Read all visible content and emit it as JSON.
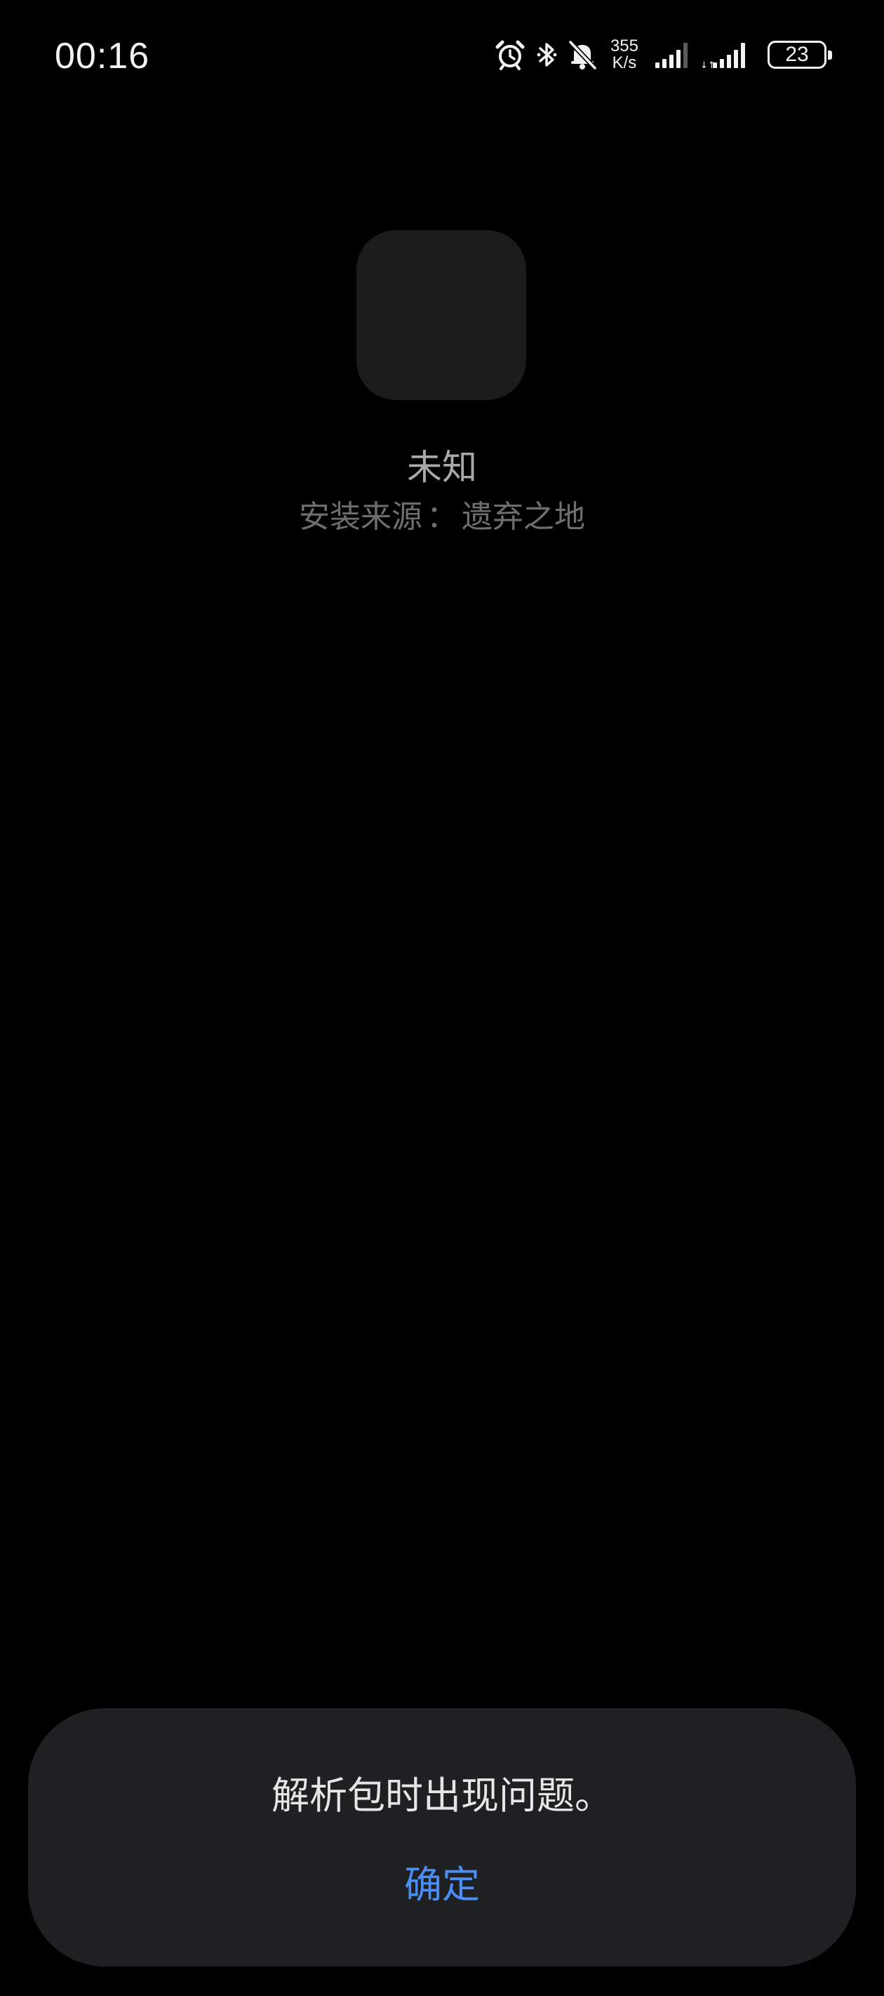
{
  "status_bar": {
    "time": "00:16",
    "net_speed_value": "355",
    "net_speed_unit": "K/s",
    "battery_level": "23",
    "icons": [
      "alarm-icon",
      "bluetooth-icon",
      "mute-icon",
      "signal-icon",
      "signal-icon-2",
      "battery-icon"
    ]
  },
  "app": {
    "name": "未知",
    "source_label": "安装来源",
    "source_separator": "：",
    "source_value": "遗弃之地"
  },
  "dialog": {
    "message": "解析包时出现问题。",
    "confirm_label": "确定"
  },
  "colors": {
    "background": "#000000",
    "dialog_background": "#1f2022",
    "accent": "#4a8df5"
  }
}
